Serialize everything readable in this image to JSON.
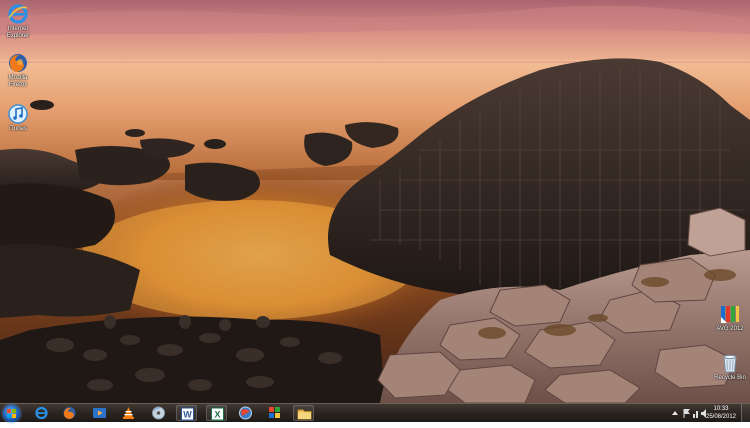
{
  "desktop": {
    "icons": [
      {
        "name": "internet-explorer",
        "label": "Internet Explorer"
      },
      {
        "name": "mozilla-firefox",
        "label": "Mozilla Firefox"
      },
      {
        "name": "itunes",
        "label": "iTunes"
      },
      {
        "name": "avg-2012",
        "label": "AVG 2012"
      },
      {
        "name": "recycle-bin",
        "label": "Recycle Bin"
      }
    ]
  },
  "taskbar": {
    "pinned": [
      {
        "name": "internet-explorer",
        "icon": "ie-icon"
      },
      {
        "name": "firefox",
        "icon": "firefox-icon"
      },
      {
        "name": "media-player",
        "icon": "media-player-icon"
      },
      {
        "name": "vlc",
        "icon": "vlc-icon"
      },
      {
        "name": "dvd-maker",
        "icon": "disc-icon"
      },
      {
        "name": "word",
        "icon": "word-icon"
      },
      {
        "name": "excel",
        "icon": "excel-icon"
      },
      {
        "name": "app",
        "icon": "globe-icon"
      },
      {
        "name": "colorful-app",
        "icon": "tiles-icon"
      },
      {
        "name": "explorer",
        "icon": "folder-icon"
      }
    ],
    "clock": {
      "time": "10:33",
      "date": "25/08/2012"
    }
  },
  "colors": {
    "taskbar": "#2b2520",
    "sky": "#d99584",
    "sea": "#efb08c"
  }
}
